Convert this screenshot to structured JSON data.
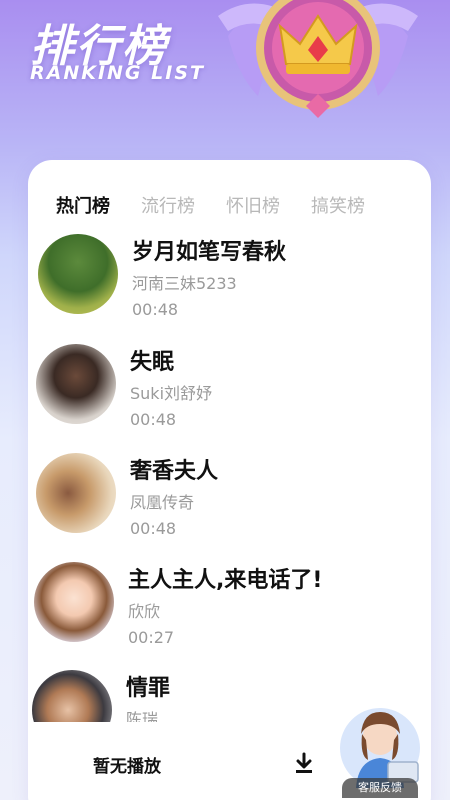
{
  "header": {
    "title": "排行榜",
    "subtitle": "RANKING LIST"
  },
  "tabs": [
    {
      "label": "热门榜",
      "active": true
    },
    {
      "label": "流行榜",
      "active": false
    },
    {
      "label": "怀旧榜",
      "active": false
    },
    {
      "label": "搞笑榜",
      "active": false
    }
  ],
  "songs": [
    {
      "title": "岁月如笔写春秋",
      "artist": "河南三妹5233",
      "duration": "00:48"
    },
    {
      "title": "失眠",
      "artist": "Suki刘舒妤",
      "duration": "00:48"
    },
    {
      "title": "奢香夫人",
      "artist": "凤凰传奇",
      "duration": "00:48"
    },
    {
      "title": "主人主人,来电话了!",
      "artist": "欣欣",
      "duration": "00:27"
    },
    {
      "title": "情罪",
      "artist": "陈瑞",
      "duration": ""
    }
  ],
  "player": {
    "status_text": "暂无播放"
  },
  "service": {
    "label": "客服反馈"
  },
  "colors": {
    "accent": "#a98ef0",
    "card": "#ffffff",
    "muted_text": "#9a9a9a"
  }
}
